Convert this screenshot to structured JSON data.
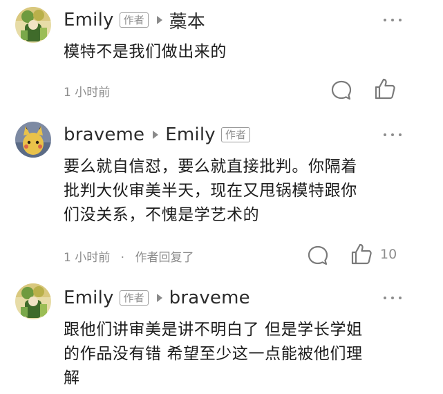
{
  "comments": [
    {
      "username": "Emily",
      "badge": "作者",
      "reply_to": "藁本",
      "reply_to_badge": "",
      "text": "模特不是我们做出来的",
      "time": "1 小时前",
      "author_replied": "",
      "likes": ""
    },
    {
      "username": "braveme",
      "badge": "",
      "reply_to": "Emily",
      "reply_to_badge": "作者",
      "text_lines": [
        "要么就自信怼，要么就直接批判。你隔着",
        "批判大伙审美半天，现在又甩锅模特跟你",
        "们没关系，不愧是学艺术的"
      ],
      "time": "1 小时前",
      "separator": "·",
      "author_replied": "作者回复了",
      "likes": "10"
    },
    {
      "username": "Emily",
      "badge": "作者",
      "reply_to": "braveme",
      "reply_to_badge": "",
      "text_lines": [
        "跟他们讲审美是讲不明白了 但是学长学姐",
        "的作品没有错 希望至少这一点能被他们理",
        "解"
      ]
    }
  ],
  "icons": {
    "reply": "comment-bubble-icon",
    "like": "thumbs-up-icon",
    "more": "more-dots-icon"
  },
  "colors": {
    "text": "#1c1c1c",
    "muted": "#8c8c8c",
    "icon": "#7a7a7a"
  }
}
